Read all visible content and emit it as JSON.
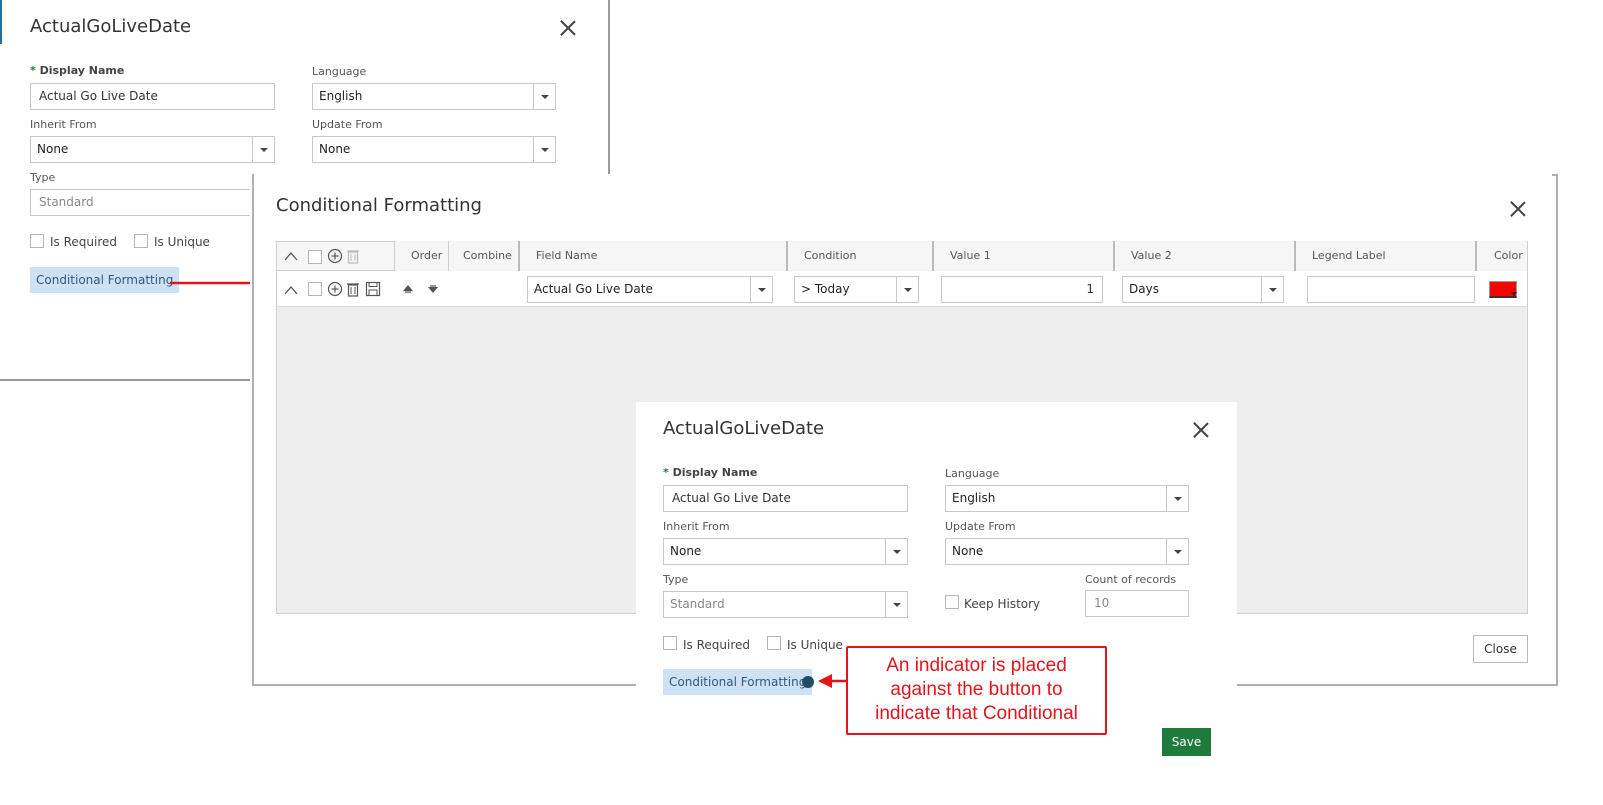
{
  "dialog_back": {
    "title": "ActualGoLiveDate",
    "display_name_label": "Display Name",
    "display_name_value": "Actual Go Live Date",
    "language_label": "Language",
    "language_value": "English",
    "inherit_from_label": "Inherit From",
    "inherit_from_value": "None",
    "update_from_label": "Update From",
    "update_from_value": "None",
    "type_label": "Type",
    "type_value": "Standard",
    "is_required_label": "Is Required",
    "is_unique_label": "Is Unique",
    "cond_format_button": "Conditional Formatting",
    "required_mark": "*"
  },
  "cf_dialog": {
    "title": "Conditional Formatting",
    "columns": [
      "Order",
      "Combine",
      "Field Name",
      "Condition",
      "Value 1",
      "Value 2",
      "Legend Label",
      "Color"
    ],
    "row": {
      "field_name": "Actual Go Live Date",
      "condition": "> Today",
      "value1": "1",
      "value2": "Days",
      "legend_label": "",
      "color": "#ff0000"
    },
    "close_button": "Close"
  },
  "dialog_front": {
    "title": "ActualGoLiveDate",
    "display_name_label": "Display Name",
    "display_name_value": "Actual Go Live Date",
    "language_label": "Language",
    "language_value": "English",
    "inherit_from_label": "Inherit From",
    "inherit_from_value": "None",
    "update_from_label": "Update From",
    "update_from_value": "None",
    "type_label": "Type",
    "type_value": "Standard",
    "keep_history_label": "Keep History",
    "count_label": "Count of records",
    "count_value": "10",
    "is_required_label": "Is Required",
    "is_unique_label": "Is Unique",
    "cond_format_button": "Conditional Formatting",
    "save_button": "Save",
    "required_mark": "*"
  },
  "annotation": {
    "text": "An indicator is placed against the button to indicate that Conditional"
  },
  "colors": {
    "accent_green": "#1e7b3c",
    "button_blue_bg": "#cfe2f3",
    "arrow_red": "#e4141b",
    "indicator": "#1f4e63"
  }
}
